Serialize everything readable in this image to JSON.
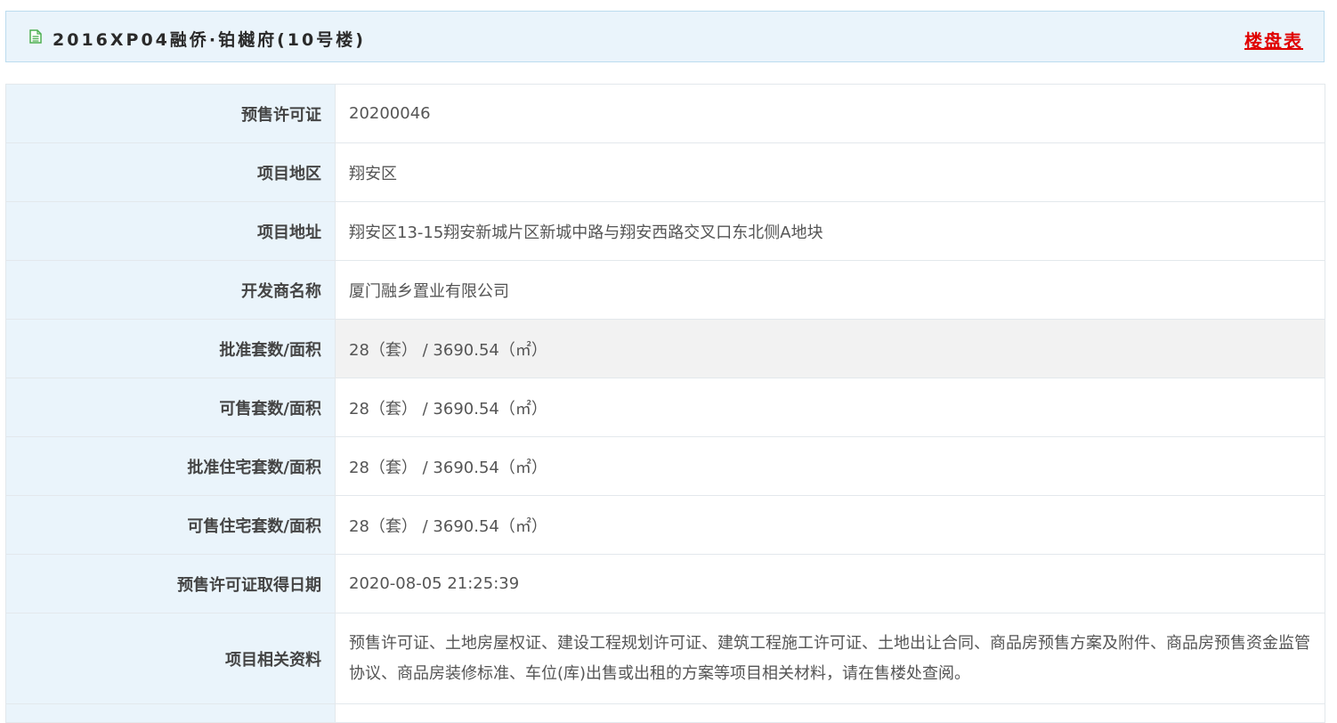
{
  "header": {
    "icon": "document-icon",
    "title": "2016XP04融侨·铂樾府(10号楼)",
    "link_label": "楼盘表",
    "link_color": "#e00000"
  },
  "rows": [
    {
      "label": "预售许可证",
      "value": "20200046"
    },
    {
      "label": "项目地区",
      "value": "翔安区"
    },
    {
      "label": "项目地址",
      "value": "翔安区13-15翔安新城片区新城中路与翔安西路交叉口东北侧A地块"
    },
    {
      "label": "开发商名称",
      "value": "厦门融乡置业有限公司"
    },
    {
      "label": "批准套数/面积",
      "value": "28（套） / 3690.54（㎡）"
    },
    {
      "label": "可售套数/面积",
      "value": "28（套） / 3690.54（㎡）"
    },
    {
      "label": "批准住宅套数/面积",
      "value": "28（套） / 3690.54（㎡）"
    },
    {
      "label": "可售住宅套数/面积",
      "value": "28（套） / 3690.54（㎡）"
    },
    {
      "label": "预售许可证取得日期",
      "value": "2020-08-05 21:25:39"
    },
    {
      "label": "项目相关资料",
      "value": "预售许可证、土地房屋权证、建设工程规划许可证、建筑工程施工许可证、土地出让合同、商品房预售方案及附件、商品房预售资金监管协议、商品房装修标准、车位(库)出售或出租的方案等项目相关材料，请在售楼处查阅。"
    }
  ]
}
